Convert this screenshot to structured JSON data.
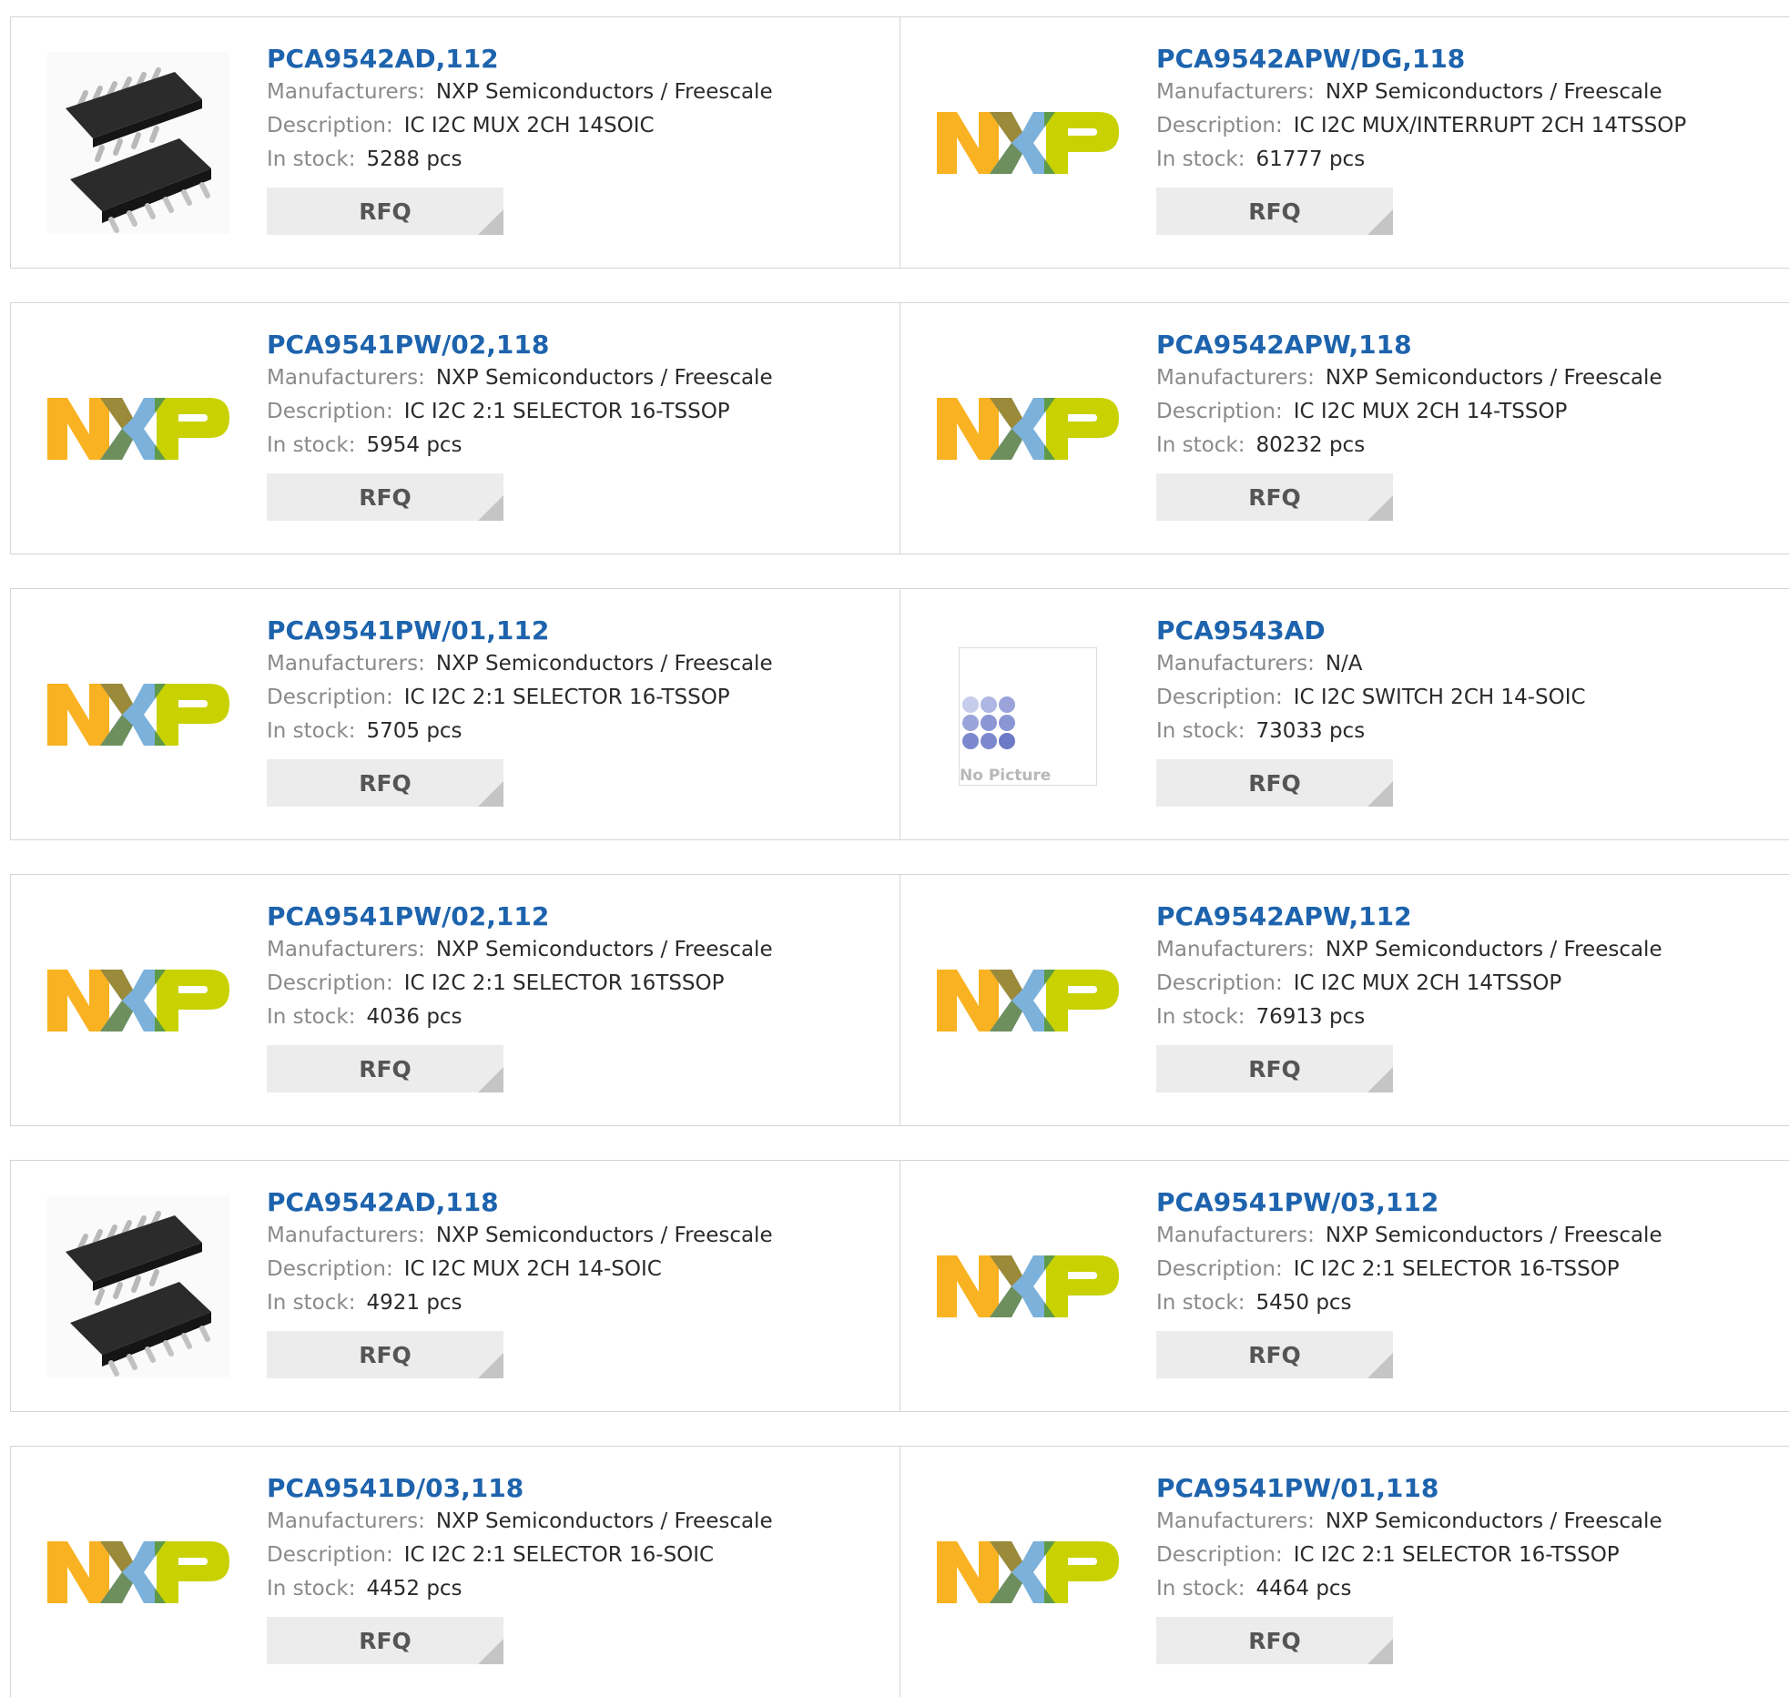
{
  "labels": {
    "manufacturer": "Manufacturers:",
    "description": "Description:",
    "stock": "In stock:",
    "rfq": "RFQ",
    "no_picture": "No Picture"
  },
  "products": [
    {
      "pn": "PCA9542AD,112",
      "manufacturer": "NXP Semiconductors / Freescale",
      "description": "IC I2C MUX 2CH 14SOIC",
      "stock": "5288 pcs",
      "image": "soic-chip"
    },
    {
      "pn": "PCA9542APW/DG,118",
      "manufacturer": "NXP Semiconductors / Freescale",
      "description": "IC I2C MUX/INTERRUPT 2CH 14TSSOP",
      "stock": "61777 pcs",
      "image": "nxp-logo"
    },
    {
      "pn": "PCA9541PW/02,118",
      "manufacturer": "NXP Semiconductors / Freescale",
      "description": "IC I2C 2:1 SELECTOR 16-TSSOP",
      "stock": "5954 pcs",
      "image": "nxp-logo"
    },
    {
      "pn": "PCA9542APW,118",
      "manufacturer": "NXP Semiconductors / Freescale",
      "description": "IC I2C MUX 2CH 14-TSSOP",
      "stock": "80232 pcs",
      "image": "nxp-logo"
    },
    {
      "pn": "PCA9541PW/01,112",
      "manufacturer": "NXP Semiconductors / Freescale",
      "description": "IC I2C 2:1 SELECTOR 16-TSSOP",
      "stock": "5705 pcs",
      "image": "nxp-logo"
    },
    {
      "pn": "PCA9543AD",
      "manufacturer": "N/A",
      "description": "IC I2C SWITCH 2CH 14-SOIC",
      "stock": "73033 pcs",
      "image": "no-picture"
    },
    {
      "pn": "PCA9541PW/02,112",
      "manufacturer": "NXP Semiconductors / Freescale",
      "description": "IC I2C 2:1 SELECTOR 16TSSOP",
      "stock": "4036 pcs",
      "image": "nxp-logo"
    },
    {
      "pn": "PCA9542APW,112",
      "manufacturer": "NXP Semiconductors / Freescale",
      "description": "IC I2C MUX 2CH 14TSSOP",
      "stock": "76913 pcs",
      "image": "nxp-logo"
    },
    {
      "pn": "PCA9542AD,118",
      "manufacturer": "NXP Semiconductors / Freescale",
      "description": "IC I2C MUX 2CH 14-SOIC",
      "stock": "4921 pcs",
      "image": "soic-chip"
    },
    {
      "pn": "PCA9541PW/03,112",
      "manufacturer": "NXP Semiconductors / Freescale",
      "description": "IC I2C 2:1 SELECTOR 16-TSSOP",
      "stock": "5450 pcs",
      "image": "nxp-logo"
    },
    {
      "pn": "PCA9541D/03,118",
      "manufacturer": "NXP Semiconductors / Freescale",
      "description": "IC I2C 2:1 SELECTOR 16-SOIC",
      "stock": "4452 pcs",
      "image": "nxp-logo"
    },
    {
      "pn": "PCA9541PW/01,118",
      "manufacturer": "NXP Semiconductors / Freescale",
      "description": "IC I2C 2:1 SELECTOR 16-TSSOP",
      "stock": "4464 pcs",
      "image": "nxp-logo"
    }
  ],
  "colors": {
    "link": "#1d63ad",
    "nxp_orange": "#f9b221",
    "nxp_blue": "#7bb1db",
    "nxp_green": "#c9d200"
  }
}
